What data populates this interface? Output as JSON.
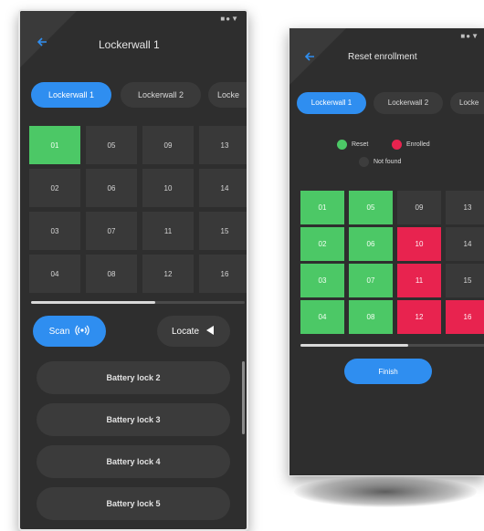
{
  "colors": {
    "accent": "#2f8ef0",
    "background": "#2e2e2e",
    "reset": "#4cc866",
    "enrolled": "#e8234f",
    "not_found": "#3d3d3d"
  },
  "screen_a": {
    "status_icons": "■●▼",
    "back_icon": "arrow-left-icon",
    "title": "Lockerwall 1",
    "tabs": [
      "Lockerwall 1",
      "Lockerwall 2",
      "Locke"
    ],
    "cells": [
      {
        "label": "01",
        "state": "reset"
      },
      {
        "label": "05",
        "state": "default"
      },
      {
        "label": "09",
        "state": "default"
      },
      {
        "label": "13",
        "state": "default"
      },
      {
        "label": "02",
        "state": "default"
      },
      {
        "label": "06",
        "state": "default"
      },
      {
        "label": "10",
        "state": "default"
      },
      {
        "label": "14",
        "state": "default"
      },
      {
        "label": "03",
        "state": "default"
      },
      {
        "label": "07",
        "state": "default"
      },
      {
        "label": "11",
        "state": "default"
      },
      {
        "label": "15",
        "state": "default"
      },
      {
        "label": "04",
        "state": "default"
      },
      {
        "label": "08",
        "state": "default"
      },
      {
        "label": "12",
        "state": "default"
      },
      {
        "label": "16",
        "state": "default"
      }
    ],
    "scan_label": "Scan",
    "locate_label": "Locate",
    "list": [
      "Battery lock 2",
      "Battery lock 3",
      "Battery lock 4",
      "Battery lock 5"
    ]
  },
  "screen_b": {
    "status_icons": "■●▼",
    "back_icon": "arrow-left-icon",
    "title": "Reset enrollment",
    "tabs": [
      "Lockerwall 1",
      "Lockerwall 2",
      "Locke"
    ],
    "legend": {
      "reset": "Reset",
      "enrolled": "Enrolled",
      "not_found": "Not found"
    },
    "cells": [
      {
        "label": "01",
        "state": "reset"
      },
      {
        "label": "05",
        "state": "reset"
      },
      {
        "label": "09",
        "state": "default"
      },
      {
        "label": "13",
        "state": "default"
      },
      {
        "label": "02",
        "state": "reset"
      },
      {
        "label": "06",
        "state": "reset"
      },
      {
        "label": "10",
        "state": "enrolled"
      },
      {
        "label": "14",
        "state": "default"
      },
      {
        "label": "03",
        "state": "reset"
      },
      {
        "label": "07",
        "state": "reset"
      },
      {
        "label": "11",
        "state": "enrolled"
      },
      {
        "label": "15",
        "state": "default"
      },
      {
        "label": "04",
        "state": "reset"
      },
      {
        "label": "08",
        "state": "reset"
      },
      {
        "label": "12",
        "state": "enrolled"
      },
      {
        "label": "16",
        "state": "enrolled"
      }
    ],
    "finish_label": "Finish"
  }
}
